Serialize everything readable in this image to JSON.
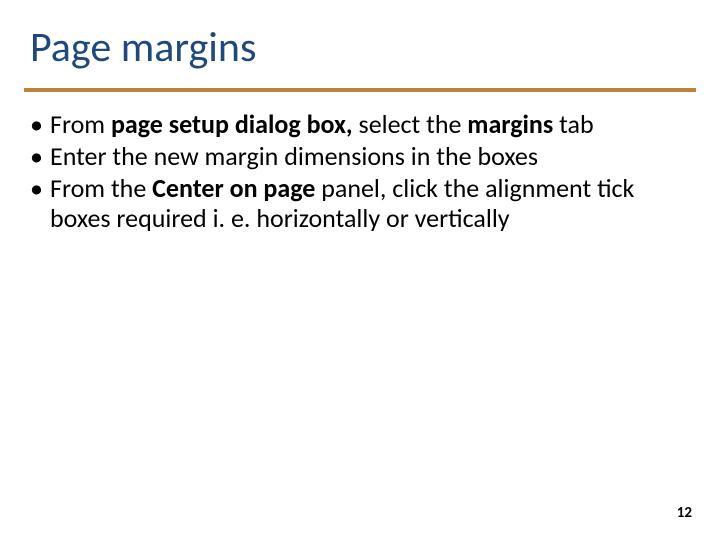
{
  "title": "Page margins",
  "bullets": [
    {
      "prefix": "From ",
      "bold1": "page setup dialog box,",
      "mid": " select the ",
      "bold2": "margins",
      "suffix": " tab"
    },
    {
      "text": "Enter the new margin dimensions in the boxes"
    },
    {
      "prefix": "From the ",
      "bold1": "Center on page",
      "suffix": " panel, click the alignment tick boxes required i. e. horizontally or vertically"
    }
  ],
  "page_number": "12"
}
